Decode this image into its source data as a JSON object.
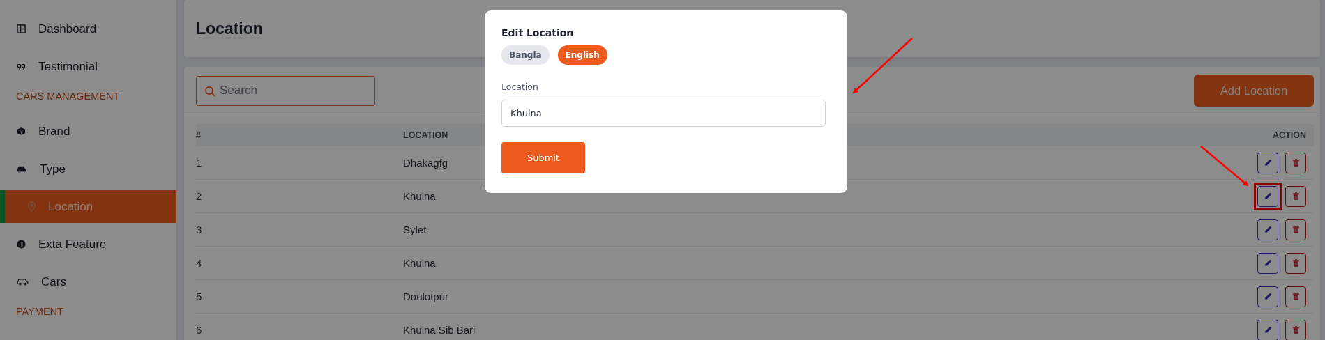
{
  "sidebar": {
    "items": [
      {
        "kind": "item",
        "label": "Dashboard",
        "selected": false
      },
      {
        "kind": "item",
        "label": "Testimonial",
        "selected": false
      },
      {
        "kind": "section",
        "label": "CARS MANAGEMENT"
      },
      {
        "kind": "item",
        "label": "Brand",
        "selected": false
      },
      {
        "kind": "item",
        "label": "Type",
        "selected": false
      },
      {
        "kind": "item",
        "label": "Location",
        "selected": true
      },
      {
        "kind": "item",
        "label": "Exta Feature",
        "selected": false
      },
      {
        "kind": "item",
        "label": "Cars",
        "selected": false
      },
      {
        "kind": "section",
        "label": "PAYMENT"
      }
    ]
  },
  "page": {
    "title": "Location"
  },
  "toolbar": {
    "search": {
      "placeholder": "Search"
    },
    "add_button": "Add Location"
  },
  "table": {
    "columns": [
      "#",
      "LOCATION",
      "ACTION"
    ],
    "rows": [
      {
        "index": "1",
        "location": "Dhakagfg",
        "highlighted": false
      },
      {
        "index": "2",
        "location": "Khulna",
        "highlighted": true
      },
      {
        "index": "3",
        "location": "Sylet",
        "highlighted": false
      },
      {
        "index": "4",
        "location": "Khulna",
        "highlighted": false
      },
      {
        "index": "5",
        "location": "Doulotpur",
        "highlighted": false
      },
      {
        "index": "6",
        "location": "Khulna Sib Bari",
        "highlighted": false
      }
    ]
  },
  "modal": {
    "title": "Edit Location",
    "tabs": [
      {
        "label": "Bangla",
        "selected": false
      },
      {
        "label": "English",
        "selected": true
      }
    ],
    "field_label": "Location",
    "field_value": "Khulna",
    "submit": "Submit"
  }
}
